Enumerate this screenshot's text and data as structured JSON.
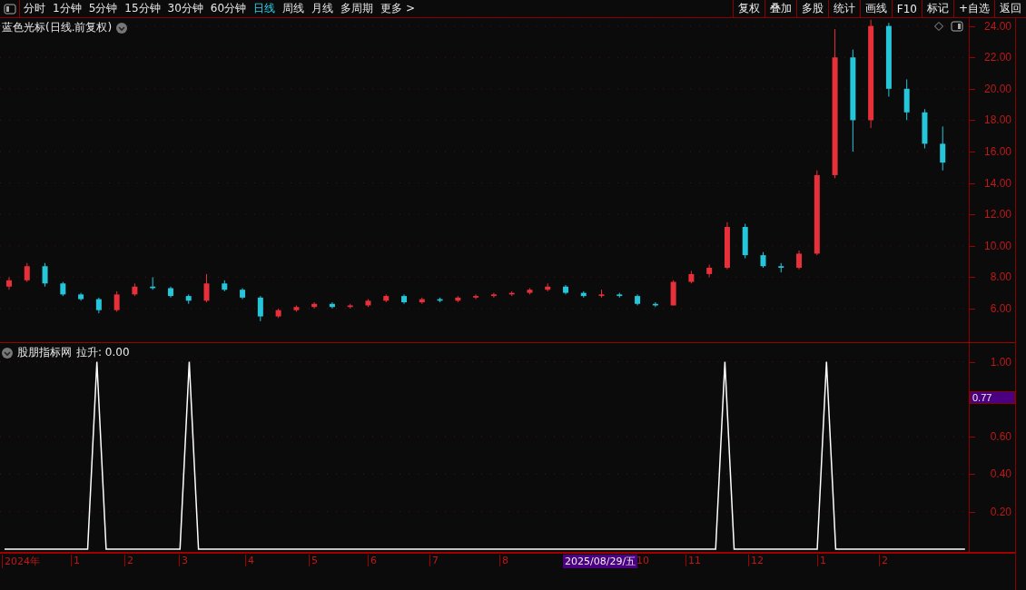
{
  "toolbar": {
    "periods": [
      {
        "label": "分时",
        "selected": false
      },
      {
        "label": "1分钟",
        "selected": false
      },
      {
        "label": "5分钟",
        "selected": false
      },
      {
        "label": "15分钟",
        "selected": false
      },
      {
        "label": "30分钟",
        "selected": false
      },
      {
        "label": "60分钟",
        "selected": false
      },
      {
        "label": "日线",
        "selected": true
      },
      {
        "label": "周线",
        "selected": false
      },
      {
        "label": "月线",
        "selected": false
      },
      {
        "label": "多周期",
        "selected": false
      }
    ],
    "more": "更多 >",
    "actions": [
      "复权",
      "叠加",
      "多股",
      "统计",
      "画线",
      "F10",
      "标记",
      "+自选",
      "返回"
    ]
  },
  "price_panel": {
    "title": "蓝色光标(日线.前复权)",
    "chart_data": {
      "type": "candlestick",
      "ylim": [
        3.8,
        24.5
      ],
      "yticks": [
        {
          "value": 24,
          "label": "24.00"
        },
        {
          "value": 22,
          "label": "22.00"
        },
        {
          "value": 20,
          "label": "20.00"
        },
        {
          "value": 18,
          "label": "18.00"
        },
        {
          "value": 16,
          "label": "16.00"
        },
        {
          "value": 14,
          "label": "14.00"
        },
        {
          "value": 12,
          "label": "12.00"
        },
        {
          "value": 10,
          "label": "10.00"
        },
        {
          "value": 8,
          "label": "8.00"
        },
        {
          "value": 6,
          "label": "6.00"
        }
      ],
      "grid": true,
      "ohlc": [
        [
          7.4,
          8.0,
          7.2,
          7.8
        ],
        [
          7.8,
          8.9,
          7.7,
          8.7
        ],
        [
          8.7,
          8.9,
          7.4,
          7.6
        ],
        [
          7.6,
          7.7,
          6.8,
          6.9
        ],
        [
          6.9,
          7.0,
          6.5,
          6.6
        ],
        [
          6.6,
          6.7,
          5.7,
          5.9
        ],
        [
          5.9,
          7.1,
          5.8,
          6.9
        ],
        [
          6.9,
          7.6,
          6.8,
          7.4
        ],
        [
          7.4,
          8.0,
          7.2,
          7.3
        ],
        [
          7.3,
          7.4,
          6.7,
          6.8
        ],
        [
          6.8,
          6.9,
          6.3,
          6.5
        ],
        [
          6.5,
          8.2,
          6.4,
          7.6
        ],
        [
          7.6,
          7.8,
          7.1,
          7.2
        ],
        [
          7.2,
          7.3,
          6.6,
          6.7
        ],
        [
          6.7,
          6.8,
          5.2,
          5.5
        ],
        [
          5.5,
          6.0,
          5.4,
          5.9
        ],
        [
          5.9,
          6.2,
          5.8,
          6.1
        ],
        [
          6.1,
          6.4,
          6.0,
          6.3
        ],
        [
          6.3,
          6.4,
          6.0,
          6.1
        ],
        [
          6.1,
          6.3,
          6.0,
          6.2
        ],
        [
          6.2,
          6.6,
          6.1,
          6.5
        ],
        [
          6.5,
          6.9,
          6.4,
          6.8
        ],
        [
          6.8,
          6.9,
          6.3,
          6.4
        ],
        [
          6.4,
          6.7,
          6.3,
          6.6
        ],
        [
          6.6,
          6.7,
          6.4,
          6.5
        ],
        [
          6.5,
          6.8,
          6.4,
          6.7
        ],
        [
          6.7,
          6.9,
          6.6,
          6.8
        ],
        [
          6.8,
          7.0,
          6.7,
          6.9
        ],
        [
          6.9,
          7.1,
          6.8,
          7.0
        ],
        [
          7.0,
          7.3,
          6.9,
          7.2
        ],
        [
          7.2,
          7.6,
          7.1,
          7.4
        ],
        [
          7.4,
          7.5,
          6.9,
          7.0
        ],
        [
          7.0,
          7.1,
          6.7,
          6.8
        ],
        [
          6.8,
          7.2,
          6.7,
          6.9
        ],
        [
          6.9,
          7.0,
          6.7,
          6.8
        ],
        [
          6.8,
          6.9,
          6.2,
          6.3
        ],
        [
          6.3,
          6.4,
          6.1,
          6.2
        ],
        [
          6.2,
          7.8,
          6.2,
          7.7
        ],
        [
          7.7,
          8.4,
          7.6,
          8.2
        ],
        [
          8.2,
          8.8,
          8.0,
          8.6
        ],
        [
          8.6,
          11.5,
          8.5,
          11.2
        ],
        [
          11.2,
          11.4,
          9.2,
          9.4
        ],
        [
          9.4,
          9.6,
          8.6,
          8.7
        ],
        [
          8.7,
          8.9,
          8.3,
          8.6
        ],
        [
          8.6,
          9.7,
          8.5,
          9.5
        ],
        [
          9.5,
          14.8,
          9.4,
          14.5
        ],
        [
          14.5,
          23.8,
          14.3,
          22.0
        ],
        [
          22.0,
          22.5,
          16.0,
          18.0
        ],
        [
          18.0,
          24.4,
          17.5,
          24.0
        ],
        [
          24.0,
          24.2,
          19.5,
          20.0
        ],
        [
          20.0,
          20.6,
          18.0,
          18.5
        ],
        [
          18.5,
          18.7,
          16.2,
          16.5
        ],
        [
          16.5,
          17.6,
          14.8,
          15.3
        ]
      ]
    }
  },
  "indicator_panel": {
    "name": "股朋指标网",
    "reading": "拉升: 0.00",
    "chart_data": {
      "type": "line",
      "ylim": [
        -0.02,
        1.1
      ],
      "grid": true,
      "yticks": [
        {
          "value": 1,
          "label": "1.00"
        },
        {
          "value": 0.6,
          "label": "0.60"
        },
        {
          "value": 0.4,
          "label": "0.40"
        },
        {
          "value": 0.2,
          "label": "0.20"
        }
      ],
      "series": [
        {
          "color": "#ffffff",
          "values": [
            0,
            0,
            0,
            0,
            0,
            0,
            0,
            0,
            0,
            0,
            1,
            0,
            0,
            0,
            0,
            0,
            0,
            0,
            0,
            0,
            1,
            0,
            0,
            0,
            0,
            0,
            0,
            0,
            0,
            0,
            0,
            0,
            0,
            0,
            0,
            0,
            0,
            0,
            0,
            0,
            0,
            0,
            0,
            0,
            0,
            0,
            0,
            0,
            0,
            0,
            0,
            0,
            0,
            0,
            0,
            0,
            0,
            0,
            0,
            0,
            0,
            0,
            0,
            0,
            0,
            0,
            0,
            0,
            0,
            0,
            0,
            0,
            0,
            0,
            0,
            0,
            0,
            0,
            1,
            0,
            0,
            0,
            0,
            0,
            0,
            0,
            0,
            0,
            0,
            1,
            0,
            0,
            0,
            0,
            0,
            0,
            0,
            0,
            0,
            0,
            0,
            0,
            0,
            0,
            0
          ]
        }
      ]
    },
    "cursor_reading": "0.77"
  },
  "date_axis": {
    "ticks": [
      "2024年",
      "1",
      "2",
      "3",
      "4",
      "5",
      "6",
      "7",
      "8",
      "10",
      "11",
      "12",
      "1",
      "2"
    ],
    "cursor": "2025/08/29/五"
  }
}
